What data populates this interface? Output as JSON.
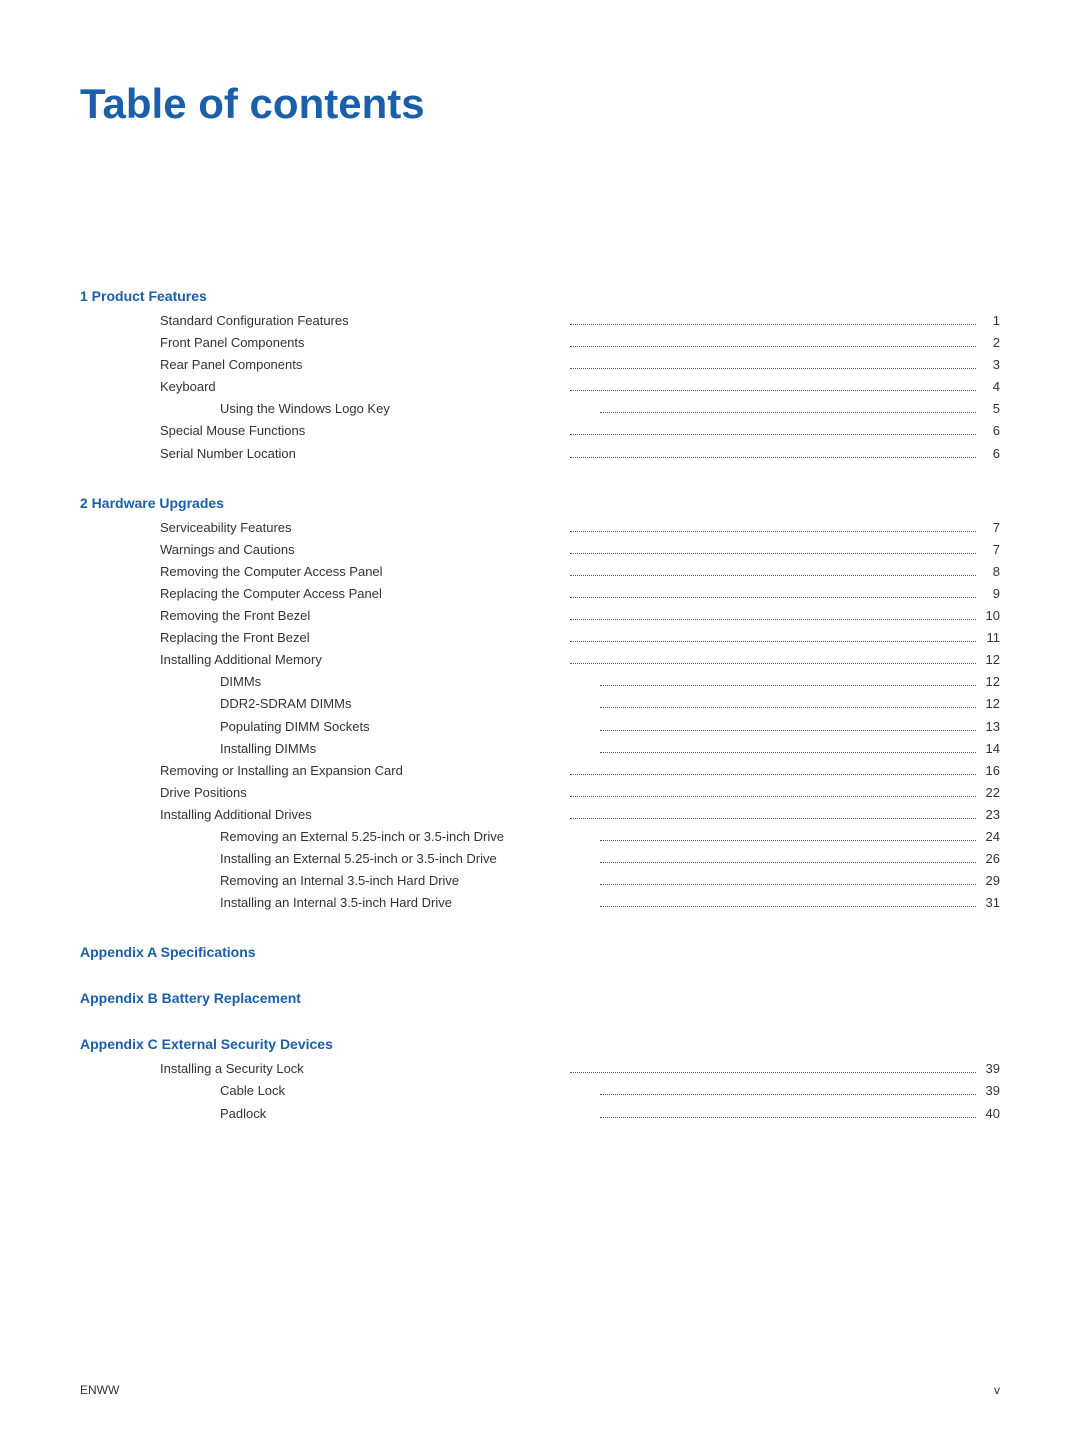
{
  "page": {
    "title": "Table of contents",
    "footer_left": "ENWW",
    "footer_right": "v"
  },
  "sections": [
    {
      "id": "section1",
      "heading": "1  Product Features",
      "entries": [
        {
          "indent": 1,
          "label": "Standard Configuration Features",
          "page": "1"
        },
        {
          "indent": 1,
          "label": "Front Panel Components",
          "page": "2"
        },
        {
          "indent": 1,
          "label": "Rear Panel Components",
          "page": "3"
        },
        {
          "indent": 1,
          "label": "Keyboard",
          "page": "4"
        },
        {
          "indent": 2,
          "label": "Using the Windows Logo Key",
          "page": "5"
        },
        {
          "indent": 1,
          "label": "Special Mouse Functions",
          "page": "6"
        },
        {
          "indent": 1,
          "label": "Serial Number Location",
          "page": "6"
        }
      ]
    },
    {
      "id": "section2",
      "heading": "2  Hardware Upgrades",
      "entries": [
        {
          "indent": 1,
          "label": "Serviceability Features",
          "page": "7"
        },
        {
          "indent": 1,
          "label": "Warnings and Cautions",
          "page": "7"
        },
        {
          "indent": 1,
          "label": "Removing the Computer Access Panel",
          "page": "8"
        },
        {
          "indent": 1,
          "label": "Replacing the Computer Access Panel",
          "page": "9"
        },
        {
          "indent": 1,
          "label": "Removing the Front Bezel",
          "page": "10"
        },
        {
          "indent": 1,
          "label": "Replacing the Front Bezel",
          "page": "11"
        },
        {
          "indent": 1,
          "label": "Installing Additional Memory",
          "page": "12"
        },
        {
          "indent": 2,
          "label": "DIMMs",
          "page": "12"
        },
        {
          "indent": 2,
          "label": "DDR2-SDRAM DIMMs",
          "page": "12"
        },
        {
          "indent": 2,
          "label": "Populating DIMM Sockets",
          "page": "13"
        },
        {
          "indent": 2,
          "label": "Installing DIMMs",
          "page": "14"
        },
        {
          "indent": 1,
          "label": "Removing or Installing an Expansion Card",
          "page": "16"
        },
        {
          "indent": 1,
          "label": "Drive Positions",
          "page": "22"
        },
        {
          "indent": 1,
          "label": "Installing Additional Drives",
          "page": "23"
        },
        {
          "indent": 2,
          "label": "Removing an External 5.25-inch or 3.5-inch Drive",
          "page": "24"
        },
        {
          "indent": 2,
          "label": "Installing an External 5.25-inch or 3.5-inch Drive",
          "page": "26"
        },
        {
          "indent": 2,
          "label": "Removing an Internal 3.5-inch Hard Drive",
          "page": "29"
        },
        {
          "indent": 2,
          "label": "Installing an Internal 3.5-inch Hard Drive",
          "page": "31"
        }
      ]
    }
  ],
  "appendices": [
    {
      "id": "appendixA",
      "heading": "Appendix A  Specifications",
      "entries": []
    },
    {
      "id": "appendixB",
      "heading": "Appendix B  Battery Replacement",
      "entries": []
    },
    {
      "id": "appendixC",
      "heading": "Appendix C  External Security Devices",
      "entries": [
        {
          "indent": 1,
          "label": "Installing a Security Lock",
          "page": "39"
        },
        {
          "indent": 2,
          "label": "Cable Lock",
          "page": "39"
        },
        {
          "indent": 2,
          "label": "Padlock",
          "page": "40"
        }
      ]
    }
  ]
}
